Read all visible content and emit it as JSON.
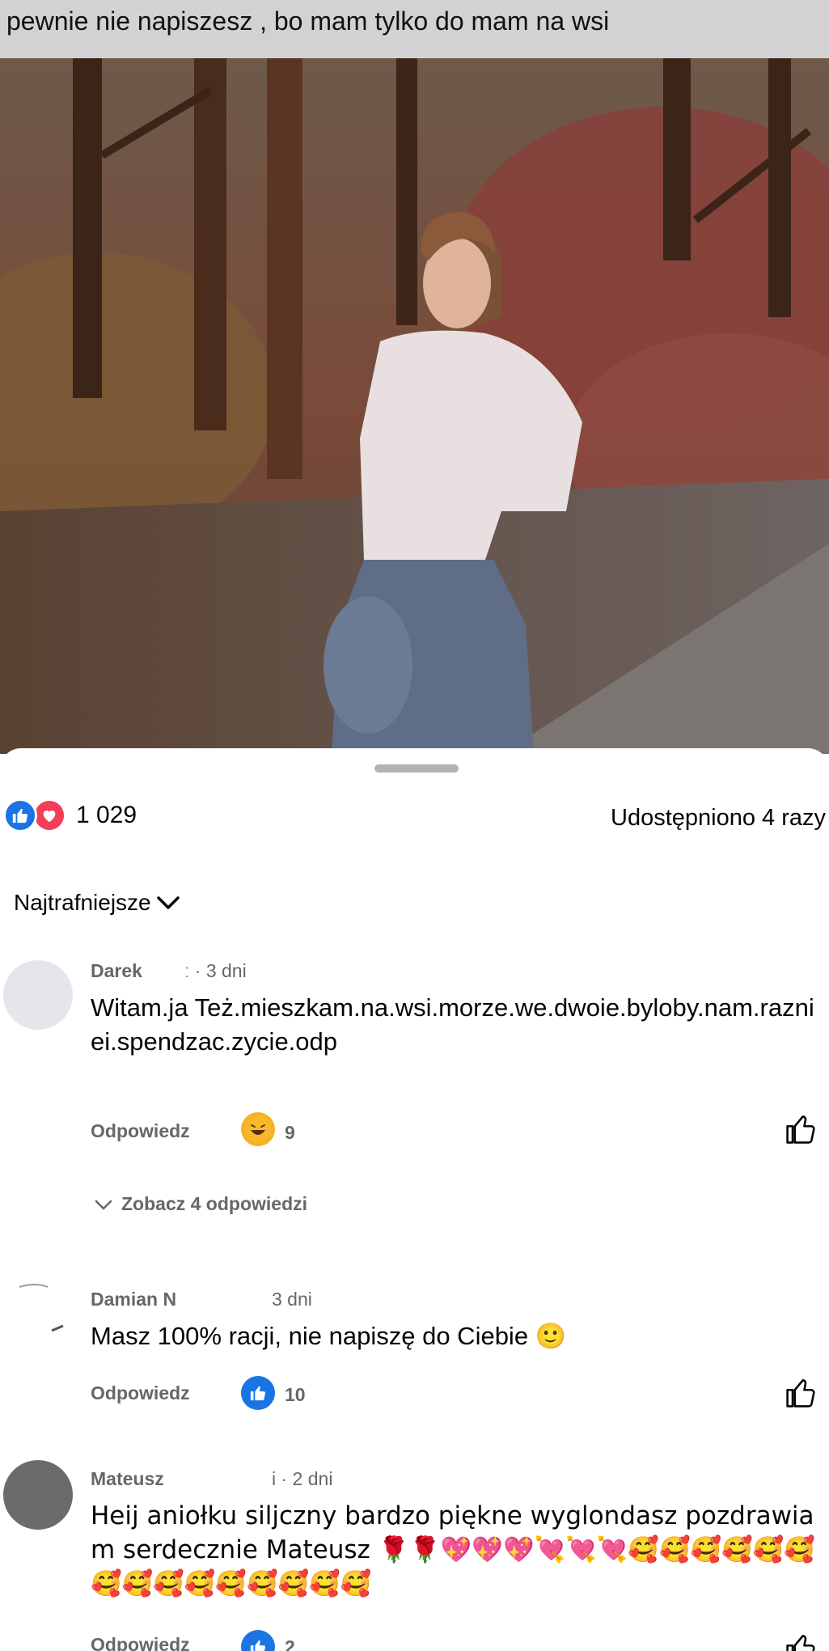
{
  "caption": "pewnie nie napiszesz , bo mam tylko do mam na wsi",
  "reactions": {
    "count": "1 029",
    "types": [
      "like-icon",
      "heart-icon"
    ]
  },
  "shares": "Udostępniono 4 razy",
  "sort": {
    "label": "Najtrafniejsze"
  },
  "comments": [
    {
      "author": "Darek",
      "meta": "ː · 3 dni",
      "text": "Witam.ja Też.mieszkam.na.wsi.morze.we.dwoie.byloby.nam.razniei.spendzac.zycie.odp",
      "reply_label": "Odpowiedz",
      "reaction_icon": "haha-icon",
      "reaction_count": "9",
      "view_replies": "Zobacz 4 odpowiedzi"
    },
    {
      "author": "Damian N",
      "meta": "3 dni",
      "text": "Masz 100% racji, nie napiszę do Ciebie 🙂",
      "reply_label": "Odpowiedz",
      "reaction_icon": "like-icon",
      "reaction_count": "10"
    },
    {
      "author": "Mateusz",
      "meta": "i · 2 dni",
      "text": "Heij aniołku siljczny bardzo piękne wyglondasz pozdrawiam serdecznie Mateusz 🌹🌹💖💖💖💘💘💘🥰🥰🥰🥰🥰🥰🥰🥰🥰🥰🥰🥰🥰🥰🥰",
      "reply_label": "Odpowiedz",
      "reaction_icon": "like-icon",
      "reaction_count": "2"
    }
  ],
  "colors": {
    "like_blue": "#1b74e4",
    "love_red": "#f33e58",
    "secondary_text": "#65676b",
    "caption_bg": "#d2d2d2"
  }
}
